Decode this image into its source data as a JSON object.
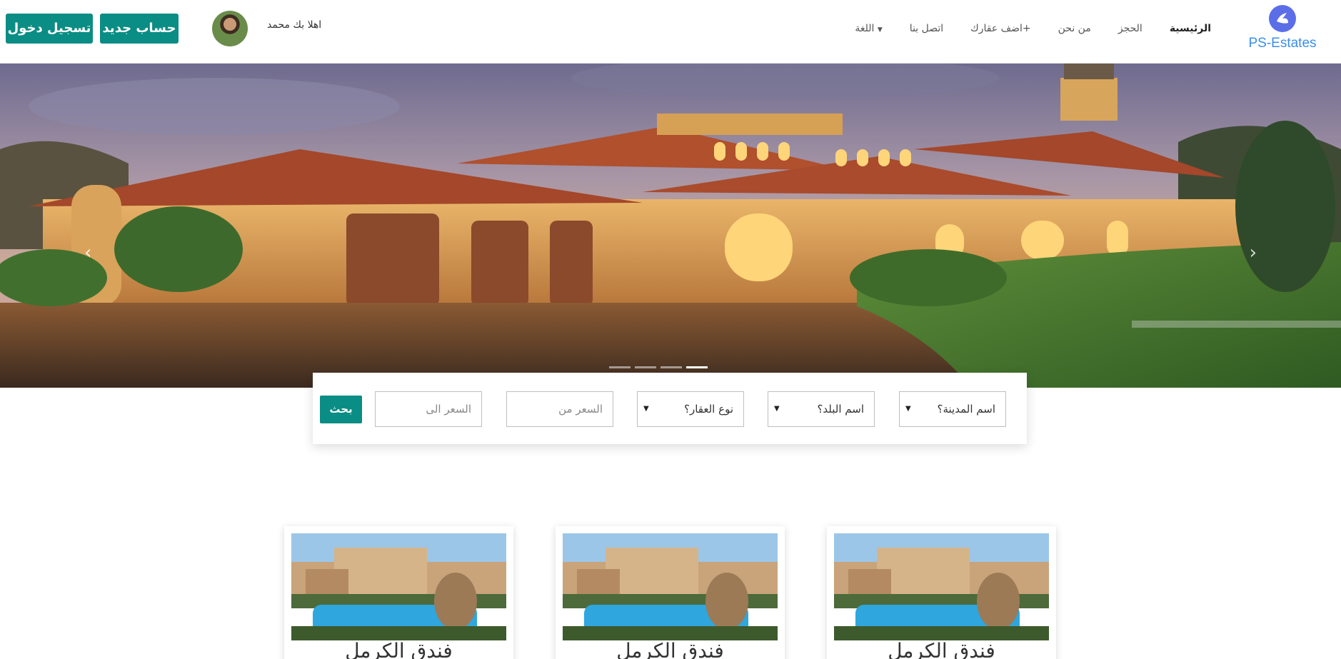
{
  "brand": {
    "name": "PS-Estates",
    "color": "#3b8ee8"
  },
  "nav": {
    "items": [
      {
        "label": "الرئيسية",
        "active": true
      },
      {
        "label": "الحجز",
        "active": false
      },
      {
        "label": "من نحن",
        "active": false
      },
      {
        "label": "اضف عقارك+",
        "active": false
      },
      {
        "label": "اتصل بنا",
        "active": false
      },
      {
        "label": "اللغة",
        "active": false,
        "dropdown": true
      }
    ]
  },
  "user": {
    "greeting": "اهلا بك محمد",
    "avatar_icon": "user-avatar"
  },
  "auth": {
    "login_label": "تسجيل دخول",
    "register_label": "حساب جديد",
    "accent": "#0a8d84"
  },
  "hero": {
    "slide_count": 4,
    "active_slide": 4,
    "prev_icon": "chevron-left-icon",
    "next_icon": "chevron-right-icon"
  },
  "search": {
    "city_label": "اسم المدينة؟",
    "country_label": "اسم البلد؟",
    "type_label": "نوع العقار؟",
    "price_from_placeholder": "السعر من",
    "price_to_placeholder": "السعر الى",
    "button_label": "بحث"
  },
  "cards": [
    {
      "title": "فندق الكرمل"
    },
    {
      "title": "فندق الكرمل"
    },
    {
      "title": "فندق الكرمل"
    }
  ]
}
